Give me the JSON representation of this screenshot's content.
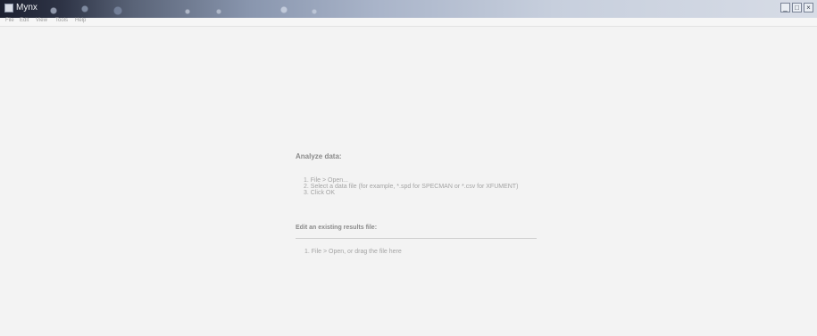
{
  "window": {
    "title": "Mynx",
    "buttons": {
      "minimize": "_",
      "maximize": "□",
      "close": "×"
    }
  },
  "menu": [
    "File",
    "Edit",
    "View",
    "Tools",
    "Help"
  ],
  "analyze": {
    "heading": "Analyze data:",
    "steps": [
      "1. File > Open...",
      "2. Select a data file (for example, *.spd for SPECMAN or *.csv for XFUMENT)",
      "3. Click OK"
    ]
  },
  "edit": {
    "heading": "Edit an existing results file:",
    "steps": [
      "1. File > Open, or drag the file here"
    ]
  },
  "icons": {
    "app": "app-icon"
  },
  "colors": {
    "titlebar_dark": "#1c2030",
    "titlebar_light": "#d7dce6",
    "background": "#f3f3f3"
  }
}
